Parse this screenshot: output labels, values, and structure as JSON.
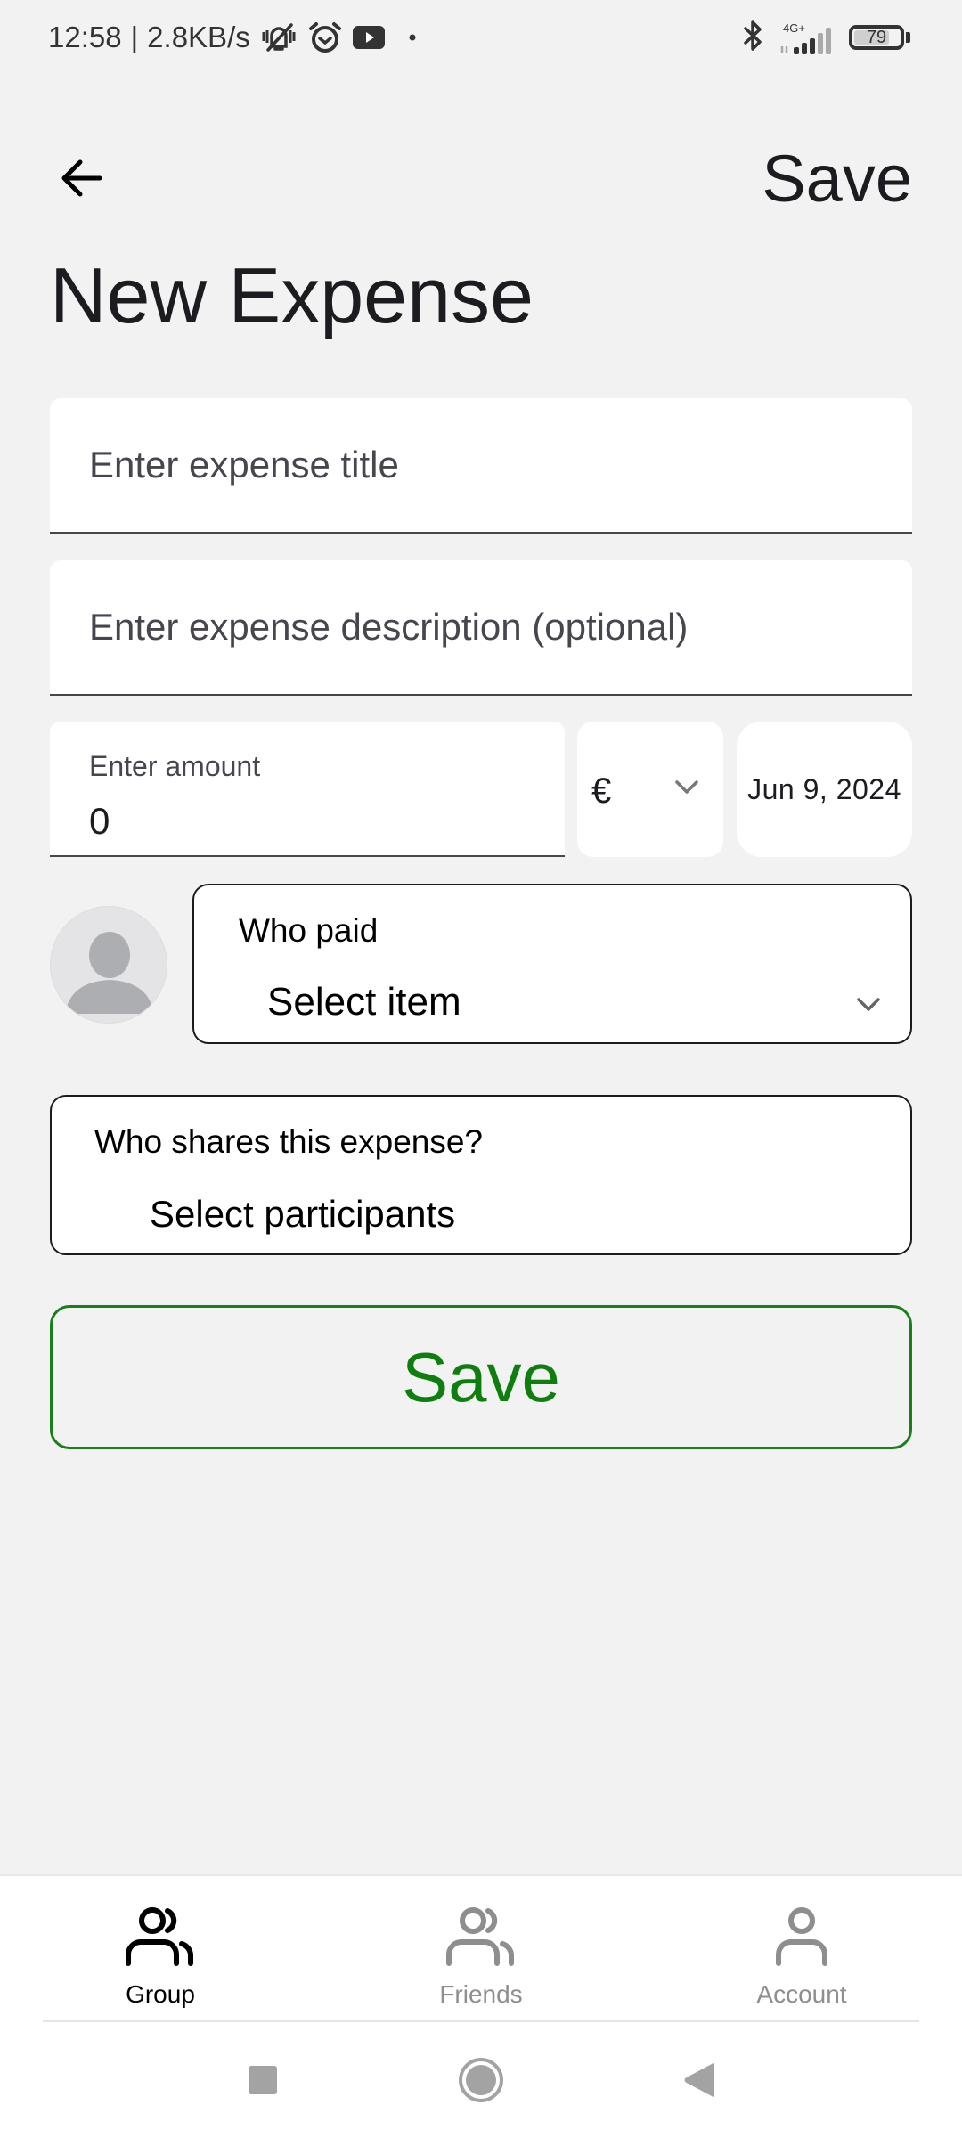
{
  "status_bar": {
    "time": "12:58",
    "separator": "|",
    "net_speed": "2.8KB/s",
    "icons": [
      "vibrate-off-icon",
      "alarm-icon",
      "youtube-icon",
      "dot-icon",
      "bluetooth-icon",
      "signal-icon",
      "battery-icon"
    ],
    "network_type": "4G+",
    "battery_level": "79",
    "battery_fraction": 0.79
  },
  "app_bar": {
    "back_icon": "arrow-left-icon",
    "save_label": "Save"
  },
  "page": {
    "title": "New Expense"
  },
  "form": {
    "title_field": {
      "value": "",
      "placeholder": "Enter expense title"
    },
    "description_field": {
      "value": "",
      "placeholder": "Enter expense description (optional)"
    },
    "amount_field": {
      "label": "Enter amount",
      "value": "0"
    },
    "currency": {
      "selected": "€",
      "icon": "chevron-down-icon"
    },
    "date": {
      "value": "Jun 9, 2024"
    },
    "who_paid": {
      "label": "Who paid",
      "selected": "Select item",
      "icon": "chevron-down-icon"
    },
    "participants": {
      "label": "Who shares this expense?",
      "selected": "Select participants"
    },
    "save_button": {
      "label": "Save"
    }
  },
  "colors": {
    "accent_green": "#0e7f0e",
    "background": "#f2f2f2",
    "nav_active": "#000000",
    "nav_inactive": "#8e8e8e"
  },
  "bottom_nav": {
    "items": [
      {
        "label": "Group",
        "icon": "group-icon",
        "active": true
      },
      {
        "label": "Friends",
        "icon": "friends-icon",
        "active": false
      },
      {
        "label": "Account",
        "icon": "account-icon",
        "active": false
      }
    ]
  },
  "system_nav": {
    "buttons": [
      "recents-button",
      "home-button",
      "back-button"
    ]
  }
}
